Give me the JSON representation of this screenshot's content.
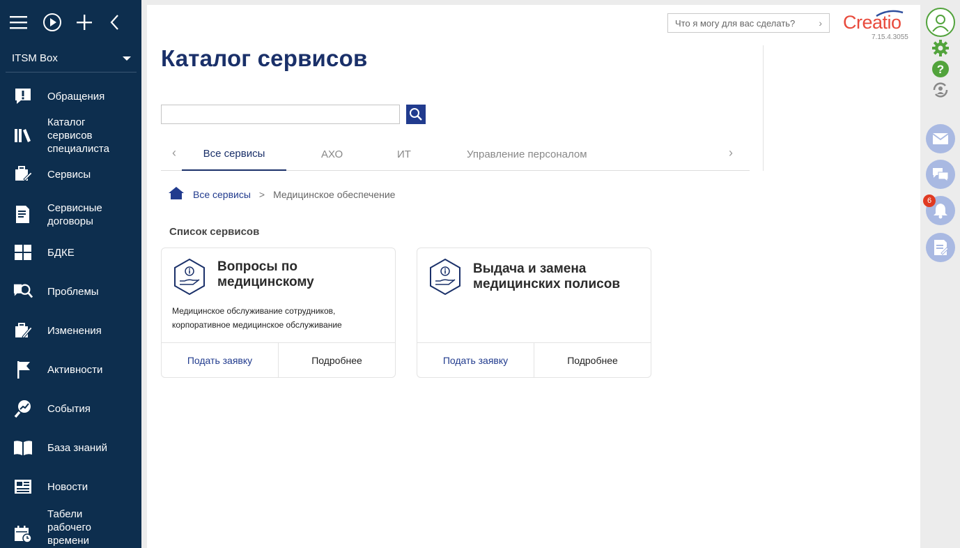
{
  "topbar": {
    "menu_icon": "hamburger-icon",
    "run_icon": "play-icon",
    "add_icon": "plus-icon",
    "collapse_icon": "chevron-left-icon"
  },
  "workspace": {
    "label": "ITSM Box"
  },
  "nav": [
    {
      "label": "Обращения",
      "icon": "exclamation-chat-icon"
    },
    {
      "label": "Каталог\nсервисов\nспециалиста",
      "icon": "books-icon"
    },
    {
      "label": "Сервисы",
      "icon": "service-icon"
    },
    {
      "label": "Сервисные\nдоговоры",
      "icon": "contract-icon"
    },
    {
      "label": "БДКЕ",
      "icon": "cmdb-icon"
    },
    {
      "label": "Проблемы",
      "icon": "problem-search-icon"
    },
    {
      "label": "Изменения",
      "icon": "change-icon"
    },
    {
      "label": "Активности",
      "icon": "flag-icon"
    },
    {
      "label": "События",
      "icon": "events-icon"
    },
    {
      "label": "База знаний",
      "icon": "book-icon"
    },
    {
      "label": "Новости",
      "icon": "news-icon"
    },
    {
      "label": "Табели\nрабочего\nвремени",
      "icon": "calendar-icon"
    }
  ],
  "header": {
    "title": "Каталог сервисов",
    "command_placeholder": "Что я могу для вас сделать?",
    "logo_text": "Creatio",
    "version": "7.15.4.3055"
  },
  "search": {
    "value": "",
    "button_icon": "search-icon"
  },
  "tabs": [
    "Все сервисы",
    "АХО",
    "ИТ",
    "Управление персоналом"
  ],
  "active_tab": "Все сервисы",
  "breadcrumb": {
    "home_icon": "home-icon",
    "root": "Все сервисы",
    "separator": ">",
    "current": "Медицинское обеспечение"
  },
  "section_title": "Список сервисов",
  "cards": [
    {
      "title": "Вопросы по медицинскому обеспечению",
      "description": "Медицинское обслуживание сотрудников, корпоративное медицинское обслуживание",
      "primary_action": "Подать заявку",
      "secondary_action": "Подробнее",
      "icon": "info-hand-icon"
    },
    {
      "title": "Выдача и замена медицинских полисов",
      "description": "",
      "primary_action": "Подать заявку",
      "secondary_action": "Подробнее",
      "icon": "info-hand-icon"
    }
  ],
  "rail": {
    "notification_count": "6",
    "items": [
      "profile-icon",
      "settings-icon",
      "help-icon",
      "sync-icon",
      "email-icon",
      "chat-icon",
      "bell-icon",
      "feed-icon"
    ]
  },
  "colors": {
    "nav_bg": "#0d2e4e",
    "accent": "#1a3069",
    "search_btn": "#213b8e",
    "logo": "#e84a3c",
    "green": "#52a33c",
    "rail_soft": "#a9b9e2"
  }
}
